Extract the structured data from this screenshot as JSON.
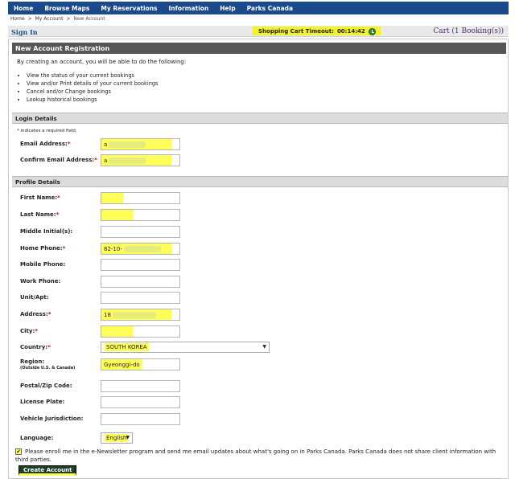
{
  "nav": {
    "items": [
      "Home",
      "Browse Maps",
      "My Reservations",
      "Information",
      "Help",
      "Parks Canada"
    ]
  },
  "breadcrumb": {
    "home": "Home",
    "sep1": ">",
    "my_account": "My Account",
    "sep2": ">",
    "current": "New Account"
  },
  "status": {
    "sign_in": "Sign In",
    "timeout_label": "Shopping Cart Timeout:",
    "timeout_value": "00:14:42",
    "cart": "Cart (1 Booking(s))"
  },
  "page": {
    "title": "New Account Registration",
    "intro": "By creating an account, you will be able to do the following:",
    "benefits": [
      "View the status of your current bookings",
      "View and/or Print details of your current bookings",
      "Cancel and/or Change bookings",
      "Lookup historical bookings"
    ]
  },
  "login": {
    "heading": "Login Details",
    "required_note": "indicates a required field.",
    "email_label": "Email Address:",
    "email_value": "a",
    "confirm_email_label": "Confirm Email Address:",
    "confirm_email_value": "a"
  },
  "profile": {
    "heading": "Profile Details",
    "first_name_label": "First Name:",
    "first_name_value": "",
    "last_name_label": "Last Name:",
    "last_name_value": "",
    "middle_initial_label": "Middle Initial(s):",
    "home_phone_label": "Home Phone:",
    "home_phone_value": "82-10-",
    "mobile_phone_label": "Mobile Phone:",
    "work_phone_label": "Work Phone:",
    "unit_label": "Unit/Apt:",
    "address_label": "Address:",
    "address_value": "18",
    "city_label": "City:",
    "city_value": "",
    "country_label": "Country:",
    "country_value": "SOUTH KOREA",
    "region_label": "Region:",
    "region_sub": "(Outside U.S. & Canada)",
    "region_value": "Gyeonggi-do",
    "postal_label": "Postal/Zip Code:",
    "license_label": "License Plate:",
    "vehicle_label": "Vehicle Jurisdiction:",
    "language_label": "Language:",
    "language_value": "English"
  },
  "newsletter": {
    "text": "Please enroll me in the e-Newsletter program and send me email updates about what's going on in Parks Canada. Parks Canada does not share client information with third parties.",
    "checked": true
  },
  "actions": {
    "create_account": "Create Account"
  },
  "colors": {
    "nav_bg": "#1b4a8c",
    "highlight": "#ffff5a",
    "section_dark": "#565656",
    "required": "#cc0000"
  }
}
